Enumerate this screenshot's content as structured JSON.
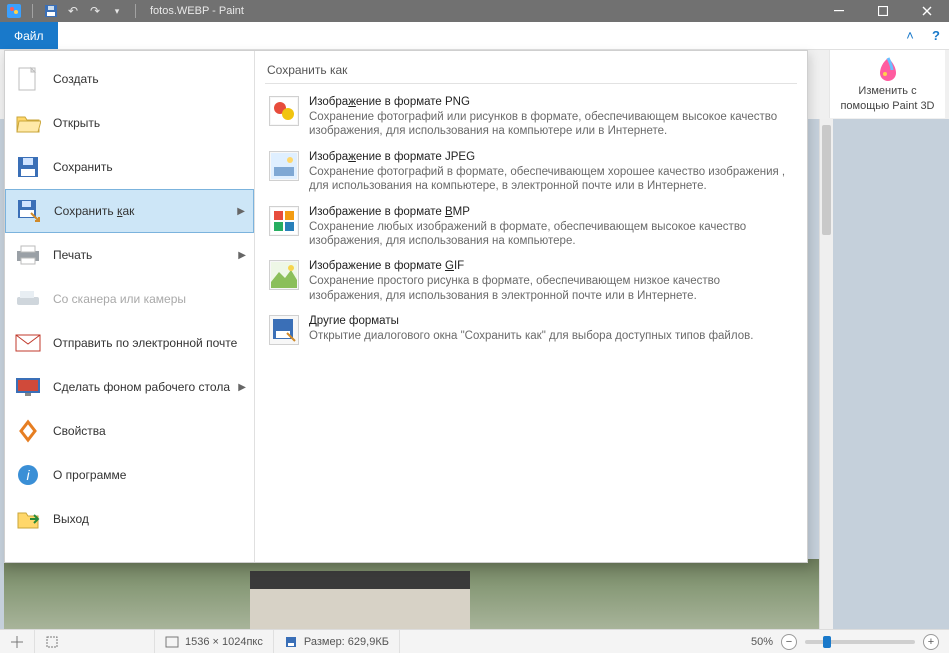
{
  "titlebar": {
    "title": "fotos.WEBP - Paint"
  },
  "ribbon": {
    "file_tab": "Файл",
    "paint3d_line1": "Изменить с",
    "paint3d_line2": "помощью Paint 3D"
  },
  "file_menu": {
    "items": [
      {
        "label": "Создать",
        "icon": "new"
      },
      {
        "label": "Открыть",
        "icon": "open"
      },
      {
        "label": "Сохранить",
        "icon": "save"
      },
      {
        "label": "Сохранить как",
        "icon": "saveas",
        "submenu": true,
        "hover": true
      },
      {
        "label": "Печать",
        "icon": "print",
        "submenu": true
      },
      {
        "label": "Со сканера или камеры",
        "icon": "scanner",
        "disabled": true
      },
      {
        "label": "Отправить по электронной почте",
        "icon": "email"
      },
      {
        "label": "Сделать фоном рабочего стола",
        "icon": "wallpaper",
        "submenu": true
      },
      {
        "label": "Свойства",
        "icon": "properties"
      },
      {
        "label": "О программе",
        "icon": "about"
      },
      {
        "label": "Выход",
        "icon": "exit"
      }
    ]
  },
  "saveas_panel": {
    "header": "Сохранить как",
    "formats": [
      {
        "title": "Изображение в формате PNG",
        "desc": "Сохранение фотографий или рисунков в формате, обеспечивающем высокое качество изображения, для использования на компьютере или в Интернете."
      },
      {
        "title": "Изображение в формате JPEG",
        "desc": "Сохранение фотографий в формате, обеспечивающем хорошее качество изображения , для использования на компьютере, в электронной почте или в Интернете."
      },
      {
        "title": "Изображение в формате BMP",
        "desc": "Сохранение любых изображений в формате, обеспечивающем высокое качество изображения, для использования на компьютере."
      },
      {
        "title": "Изображение в формате GIF",
        "desc": "Сохранение простого рисунка в формате, обеспечивающем низкое качество изображения, для использования в электронной почте или в Интернете."
      },
      {
        "title": "Другие форматы",
        "desc": "Открытие диалогового окна \"Сохранить как\" для выбора доступных типов файлов."
      }
    ]
  },
  "statusbar": {
    "dims": "1536 × 1024пкс",
    "size_label": "Размер: 629,9КБ",
    "zoom": "50%"
  },
  "colors": {
    "accent": "#1979ca"
  }
}
